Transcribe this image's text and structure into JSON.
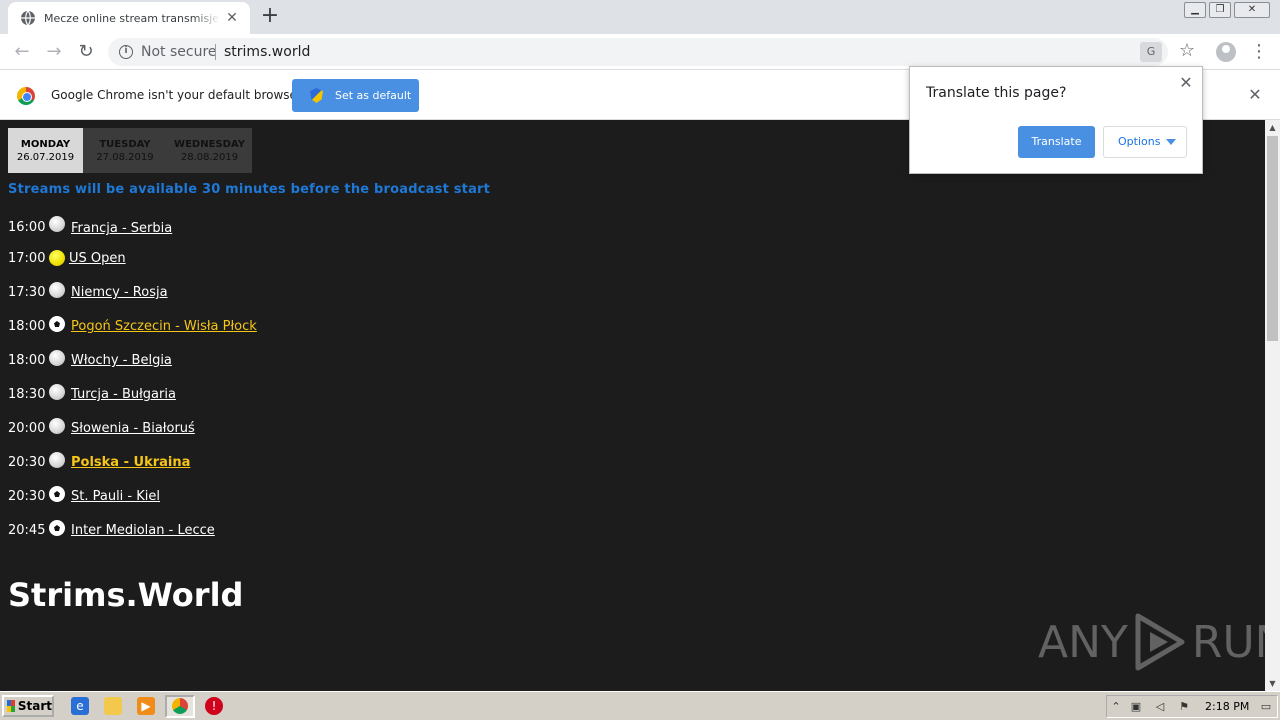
{
  "browser": {
    "tab_title": "Mecze online stream transmisje sportowe",
    "tab_close": "✕",
    "new_tab": "+",
    "window_buttons": {
      "minimize": "▁",
      "maximize": "❐",
      "close": "✕"
    },
    "nav": {
      "back": "←",
      "forward": "→",
      "reload": "↻"
    },
    "security_label": "Not secure",
    "url": "strims.world",
    "translate_icon": "G",
    "star": "☆",
    "menu": "⋮"
  },
  "infobar": {
    "message": "Google Chrome isn't your default browser",
    "button_label": "Set as default",
    "close": "✕"
  },
  "translate_popup": {
    "title": "Translate this page?",
    "translate_label": "Translate",
    "options_label": "Options",
    "close": "✕"
  },
  "page": {
    "days": [
      {
        "name": "MONDAY",
        "date": "26.07.2019"
      },
      {
        "name": "TUESDAY",
        "date": "27.08.2019"
      },
      {
        "name": "WEDNESDAY",
        "date": "28.08.2019"
      }
    ],
    "notice": "Streams will be available 30 minutes before the broadcast start",
    "matches": [
      {
        "time": "16:00",
        "sport": "volleyball",
        "title": "Francja - Serbia"
      },
      {
        "time": "17:00",
        "sport": "tennis",
        "title": "US Open"
      },
      {
        "time": "17:30",
        "sport": "volleyball",
        "title": "Niemcy - Rosja"
      },
      {
        "time": "18:00",
        "sport": "football",
        "title": "Pogoń Szczecin - Wisła Płock"
      },
      {
        "time": "18:00",
        "sport": "volleyball",
        "title": "Włochy - Belgia"
      },
      {
        "time": "18:30",
        "sport": "volleyball",
        "title": "Turcja - Bułgaria"
      },
      {
        "time": "20:00",
        "sport": "volleyball",
        "title": "Słowenia - Białoruś"
      },
      {
        "time": "20:30",
        "sport": "volleyball",
        "title": "Polska - Ukraina"
      },
      {
        "time": "20:30",
        "sport": "football",
        "title": "St. Pauli - Kiel"
      },
      {
        "time": "20:45",
        "sport": "football",
        "title": "Inter Mediolan - Lecce"
      }
    ],
    "site_title": "Strims.World",
    "watermark_left": "ANY",
    "watermark_right": "RUN"
  },
  "taskbar": {
    "start_label": "Start",
    "clock": "2:18 PM"
  },
  "colors": {
    "page_bg": "#1c1c1c",
    "notice": "#1e78d6",
    "highlight": "#f5c518",
    "accent_button": "#4a90e2"
  }
}
